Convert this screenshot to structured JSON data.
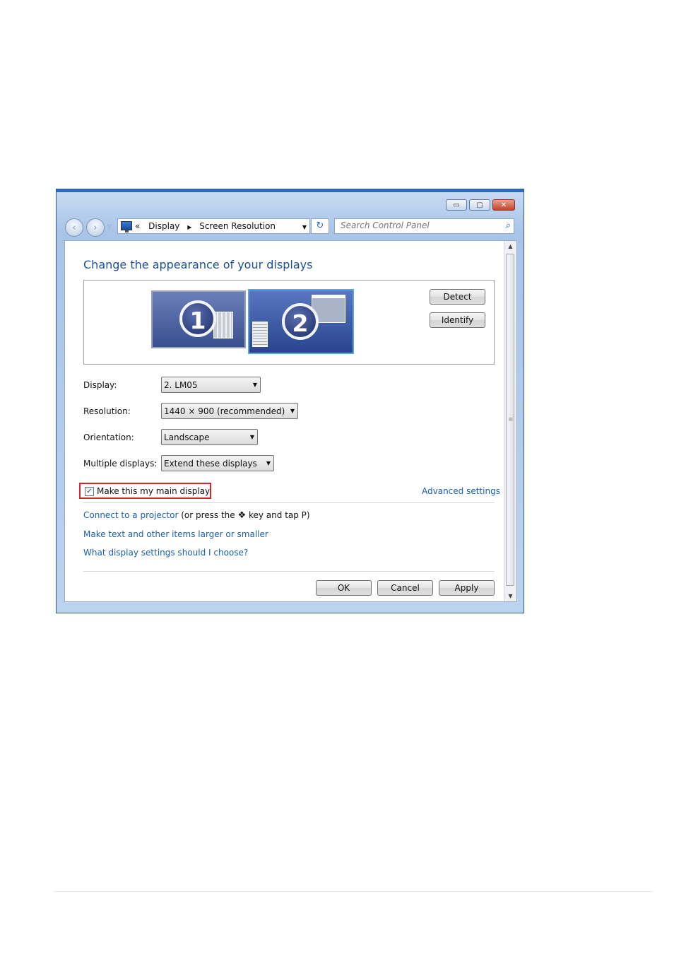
{
  "window": {
    "controls": {
      "minimize": "▭",
      "maximize": "▢",
      "close": "✕"
    },
    "nav": {
      "back": "‹",
      "forward": "›",
      "dropdown": "▽"
    },
    "address": {
      "prefix": "«",
      "crumb1": "Display",
      "separator": "▶",
      "crumb2": "Screen Resolution",
      "arrow": "▼"
    },
    "refresh": "↻",
    "search": {
      "placeholder": "Search Control Panel",
      "icon": "⌕"
    }
  },
  "content": {
    "title": "Change the appearance of your displays",
    "monitors": [
      {
        "number": "1"
      },
      {
        "number": "2"
      }
    ],
    "buttons": {
      "detect": "Detect",
      "identify": "Identify"
    },
    "fields": {
      "display": {
        "label": "Display:",
        "value": "2. LM05"
      },
      "resolution": {
        "label": "Resolution:",
        "value": "1440 × 900 (recommended)"
      },
      "orientation": {
        "label": "Orientation:",
        "value": "Landscape"
      },
      "multiple": {
        "label": "Multiple displays:",
        "value": "Extend these displays"
      }
    },
    "dropdown_arrow": "▼",
    "main_display": {
      "label": "Make this my main display",
      "checked": true,
      "mark": "✓"
    },
    "advanced_link": "Advanced settings",
    "links": {
      "projector": "Connect to a projector",
      "projector_pre": "(or press the",
      "win_key": "❖",
      "projector_post": "key and tap P)",
      "text_size": "Make text and other items larger or smaller",
      "help": "What display settings should I choose?"
    },
    "footer": {
      "ok": "OK",
      "cancel": "Cancel",
      "apply": "Apply"
    },
    "scrollbar": {
      "up": "▲",
      "down": "▼",
      "grip": "≡"
    }
  }
}
